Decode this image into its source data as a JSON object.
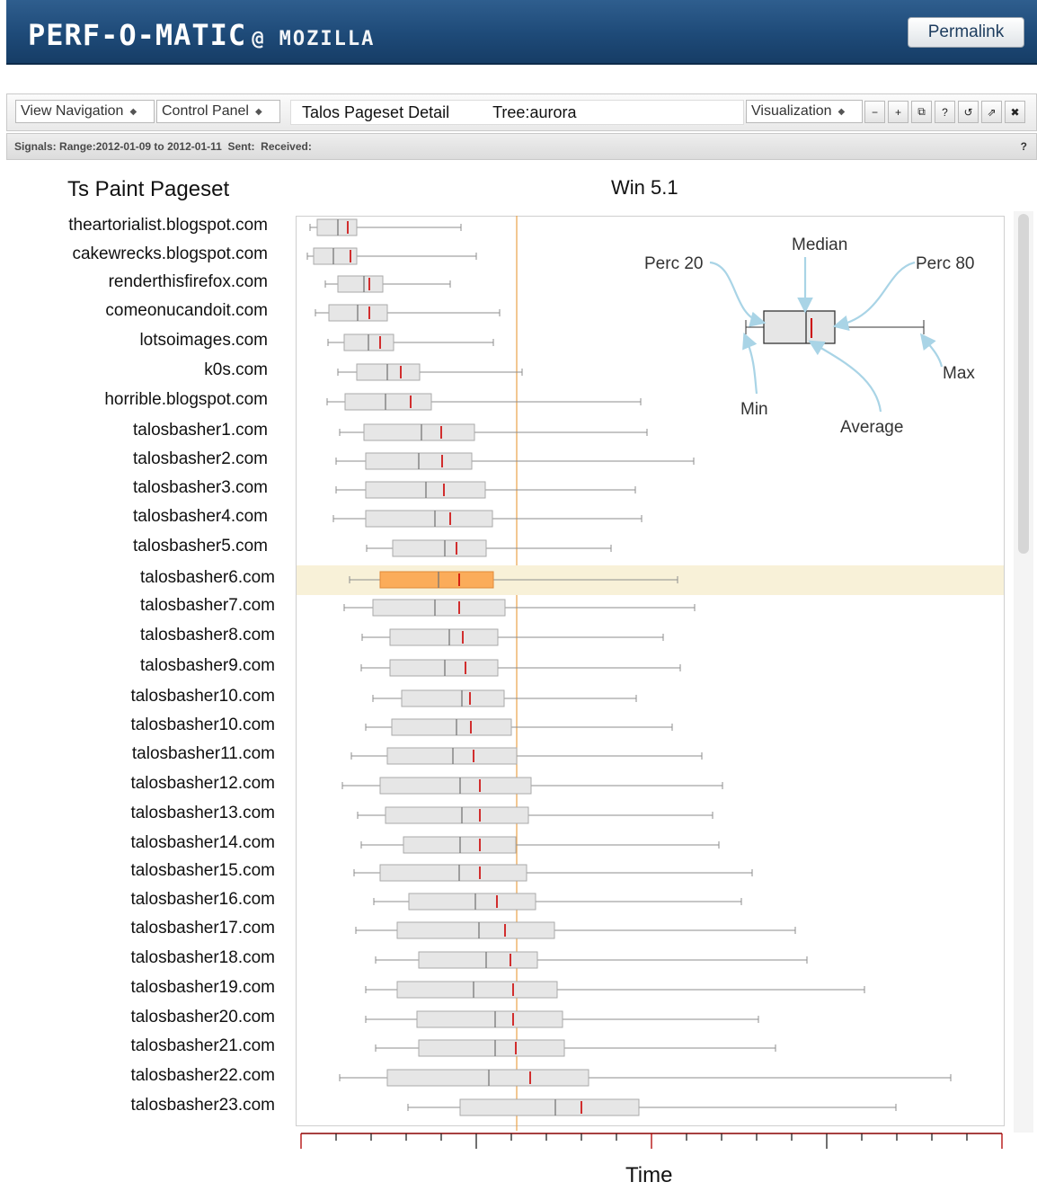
{
  "header": {
    "brand": "PERF-O-MATIC",
    "brand_suffix": "@ MOZILLA",
    "permalink_label": "Permalink"
  },
  "toolbar": {
    "view_navigation": "View Navigation",
    "control_panel": "Control Panel",
    "title": "Talos Pageset Detail",
    "tree": "Tree:aurora",
    "visualization": "Visualization",
    "icons": [
      "minus-circle-icon",
      "plus-circle-icon",
      "windows-icon",
      "help-icon",
      "refresh-icon",
      "popout-icon",
      "close-icon"
    ],
    "icon_glyphs": [
      "−",
      "+",
      "⧉",
      "?",
      "↺",
      "⇗",
      "✖"
    ]
  },
  "signals": {
    "label": "Signals:",
    "range": "Range:2012-01-09 to 2012-01-11",
    "sent": "Sent:",
    "received": "Received:",
    "help": "?"
  },
  "chart": {
    "panel_title": "Ts Paint Pageset",
    "platform_title": "Win 5.1",
    "xlabel": "Time",
    "legend": {
      "min": "Min",
      "perc20": "Perc 20",
      "median": "Median",
      "perc80": "Perc 80",
      "max": "Max",
      "average": "Average"
    }
  },
  "colors": {
    "box_fill": "#e6e6e6",
    "box_stroke": "#aaaaaa",
    "highlight_box": "#fbac5a",
    "highlight_band": "#f8f1d8",
    "average_mark": "#cc0000",
    "reference_line": "#e8a24a",
    "legend_arrow": "#a9d4e6"
  },
  "chart_data": {
    "type": "box",
    "highlighted": "talosbasher6.com",
    "series": [
      {
        "name": "theartorialist.blogspot.com",
        "min": 345,
        "p20": 353,
        "median": 376,
        "p80": 397,
        "max": 513,
        "avg": 387
      },
      {
        "name": "cakewrecks.blogspot.com",
        "min": 342,
        "p20": 349,
        "median": 371,
        "p80": 397,
        "max": 530,
        "avg": 390
      },
      {
        "name": "renderthisfirefox.com",
        "min": 362,
        "p20": 376,
        "median": 405,
        "p80": 426,
        "max": 501,
        "avg": 411
      },
      {
        "name": "comeonucandoit.com",
        "min": 351,
        "p20": 366,
        "median": 398,
        "p80": 431,
        "max": 556,
        "avg": 411
      },
      {
        "name": "lotsoimages.com",
        "min": 365,
        "p20": 383,
        "median": 410,
        "p80": 438,
        "max": 549,
        "avg": 423
      },
      {
        "name": "k0s.com",
        "min": 376,
        "p20": 397,
        "median": 431,
        "p80": 467,
        "max": 581,
        "avg": 446
      },
      {
        "name": "horrible.blogspot.com",
        "min": 364,
        "p20": 384,
        "median": 429,
        "p80": 480,
        "max": 713,
        "avg": 457
      },
      {
        "name": "talosbasher1.com",
        "min": 378,
        "p20": 405,
        "median": 469,
        "p80": 528,
        "max": 720,
        "avg": 491
      },
      {
        "name": "talosbasher2.com",
        "min": 374,
        "p20": 407,
        "median": 466,
        "p80": 525,
        "max": 772,
        "avg": 492
      },
      {
        "name": "talosbasher3.com",
        "min": 374,
        "p20": 407,
        "median": 474,
        "p80": 540,
        "max": 707,
        "avg": 494
      },
      {
        "name": "talosbasher4.com",
        "min": 371,
        "p20": 407,
        "median": 484,
        "p80": 548,
        "max": 714,
        "avg": 501
      },
      {
        "name": "talosbasher5.com",
        "min": 408,
        "p20": 437,
        "median": 495,
        "p80": 541,
        "max": 680,
        "avg": 508
      },
      {
        "name": "talosbasher6.com",
        "min": 389,
        "p20": 423,
        "median": 488,
        "p80": 549,
        "max": 754,
        "avg": 511
      },
      {
        "name": "talosbasher7.com",
        "min": 383,
        "p20": 415,
        "median": 484,
        "p80": 562,
        "max": 773,
        "avg": 511
      },
      {
        "name": "talosbasher8.com",
        "min": 403,
        "p20": 434,
        "median": 500,
        "p80": 554,
        "max": 738,
        "avg": 515
      },
      {
        "name": "talosbasher9.com",
        "min": 402,
        "p20": 434,
        "median": 495,
        "p80": 554,
        "max": 757,
        "avg": 518
      },
      {
        "name": "talosbasher10.com",
        "min": 415,
        "p20": 447,
        "median": 514,
        "p80": 561,
        "max": 708,
        "avg": 523
      },
      {
        "name": "talosbasher10.com",
        "min": 407,
        "p20": 436,
        "median": 508,
        "p80": 569,
        "max": 748,
        "avg": 524
      },
      {
        "name": "talosbasher11.com",
        "min": 391,
        "p20": 431,
        "median": 504,
        "p80": 575,
        "max": 781,
        "avg": 527
      },
      {
        "name": "talosbasher12.com",
        "min": 381,
        "p20": 423,
        "median": 512,
        "p80": 591,
        "max": 804,
        "avg": 534
      },
      {
        "name": "talosbasher13.com",
        "min": 398,
        "p20": 429,
        "median": 514,
        "p80": 588,
        "max": 793,
        "avg": 534
      },
      {
        "name": "talosbasher14.com",
        "min": 402,
        "p20": 449,
        "median": 512,
        "p80": 574,
        "max": 800,
        "avg": 534
      },
      {
        "name": "talosbasher15.com",
        "min": 394,
        "p20": 423,
        "median": 511,
        "p80": 586,
        "max": 837,
        "avg": 534
      },
      {
        "name": "talosbasher16.com",
        "min": 416,
        "p20": 455,
        "median": 529,
        "p80": 596,
        "max": 825,
        "avg": 553
      },
      {
        "name": "talosbasher17.com",
        "min": 396,
        "p20": 442,
        "median": 533,
        "p80": 617,
        "max": 885,
        "avg": 562
      },
      {
        "name": "talosbasher18.com",
        "min": 418,
        "p20": 466,
        "median": 541,
        "p80": 598,
        "max": 898,
        "avg": 568
      },
      {
        "name": "talosbasher19.com",
        "min": 407,
        "p20": 442,
        "median": 527,
        "p80": 620,
        "max": 962,
        "avg": 571
      },
      {
        "name": "talosbasher20.com",
        "min": 407,
        "p20": 464,
        "median": 551,
        "p80": 626,
        "max": 844,
        "avg": 571
      },
      {
        "name": "talosbasher21.com",
        "min": 418,
        "p20": 466,
        "median": 551,
        "p80": 628,
        "max": 863,
        "avg": 574
      },
      {
        "name": "talosbasher22.com",
        "min": 378,
        "p20": 431,
        "median": 544,
        "p80": 655,
        "max": 1058,
        "avg": 590
      },
      {
        "name": "talosbasher23.com",
        "min": 454,
        "p20": 512,
        "median": 618,
        "p80": 711,
        "max": 997,
        "avg": 647
      }
    ],
    "reference_value": 575
  }
}
